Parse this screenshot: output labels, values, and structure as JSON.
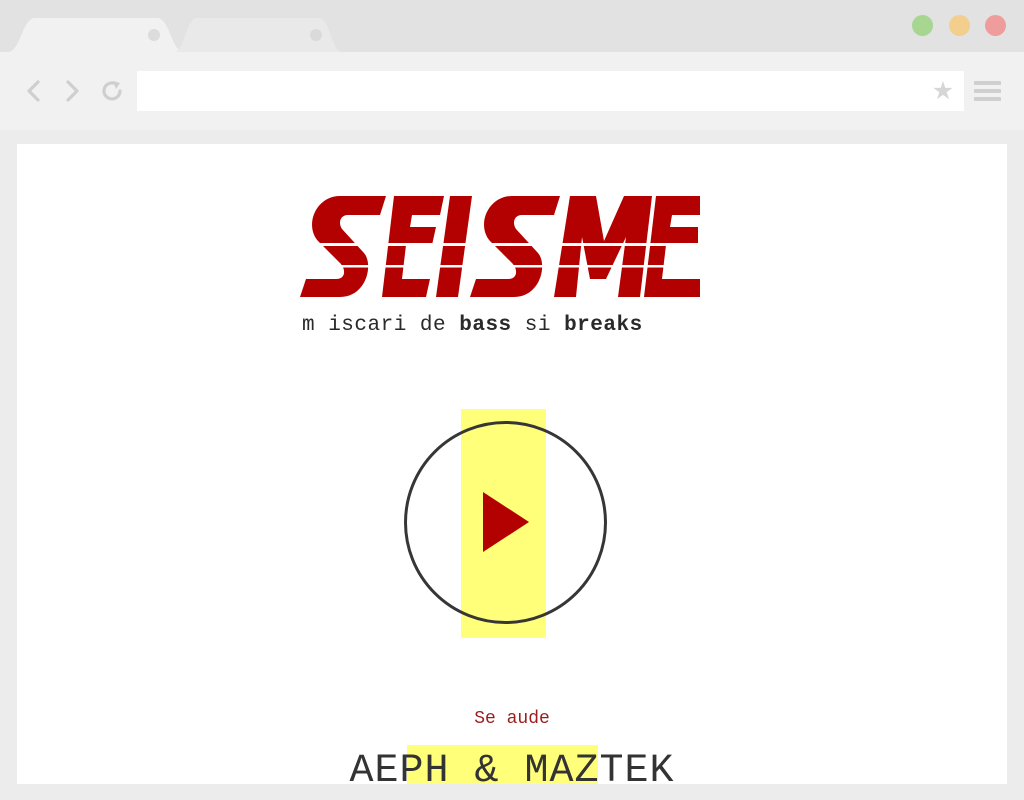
{
  "browser": {
    "address_value": "",
    "dot_colors": {
      "green": "#a6d690",
      "yellow": "#f2cf8c",
      "red": "#ee9c9c"
    },
    "icons": [
      "back-icon",
      "forward-icon",
      "reload-icon",
      "star-icon",
      "menu-icon"
    ]
  },
  "page": {
    "logo_text": "SEISME",
    "brand_color": "#b30000",
    "tagline": {
      "part1": "m iscari de ",
      "bold1": "bass",
      "part2": " si ",
      "bold2": "breaks"
    },
    "play_icon": "play-icon",
    "highlight_color": "#ffff7a",
    "now_playing_label": "Se aude",
    "artist": "AEPH & MAZTEK"
  }
}
